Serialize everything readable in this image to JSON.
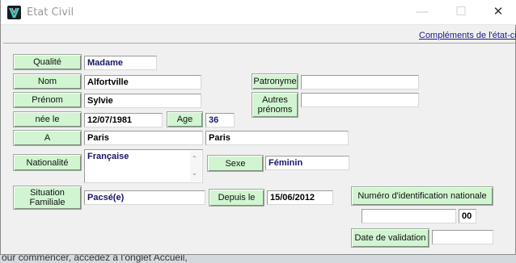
{
  "window": {
    "title": "Etat Civil"
  },
  "header": {
    "link_text": "Compléments de l'état-civ"
  },
  "form": {
    "qualite": {
      "label": "Qualité",
      "value": "Madame"
    },
    "nom": {
      "label": "Nom",
      "value": "Alfortville"
    },
    "patronyme": {
      "label": "Patronyme",
      "value": ""
    },
    "prenom": {
      "label": "Prénom",
      "value": "Sylvie"
    },
    "autres_prenoms": {
      "label": "Autres prénoms",
      "value": ""
    },
    "nee_le": {
      "label": "née le",
      "value": "12/07/1981"
    },
    "age": {
      "label": "Age",
      "value": "36"
    },
    "a": {
      "label": "A",
      "value": "Paris",
      "value2": "Paris"
    },
    "nationalite": {
      "label": "Nationalité",
      "value": "Française"
    },
    "sexe": {
      "label": "Sexe",
      "value": "Féminin"
    },
    "situation": {
      "label": "Situation Familiale",
      "value": "Pacsé(e)"
    },
    "depuis_le": {
      "label": "Depuis le",
      "value": "15/06/2012"
    },
    "numero_id": {
      "label": "Numéro d'identification nationale",
      "value": "",
      "key": "00"
    },
    "date_validation": {
      "label": "Date de validation",
      "value": ""
    }
  },
  "background": {
    "text": "our commencer, accédez à l'onglet Accueil,"
  }
}
